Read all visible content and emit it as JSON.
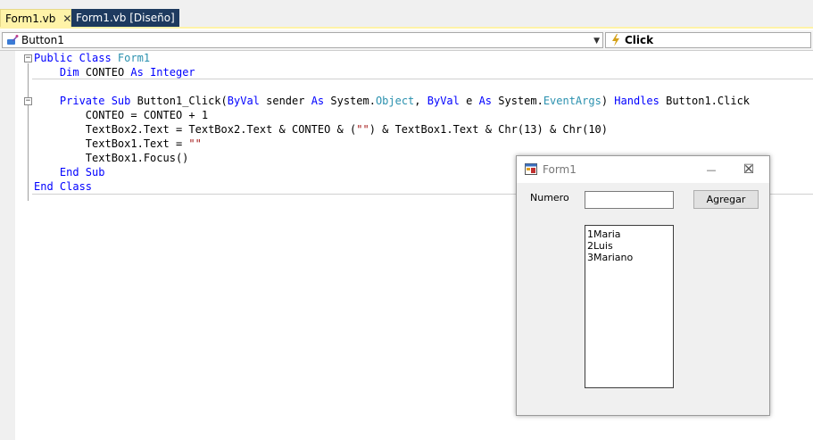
{
  "tabs": {
    "active_label": "Form1.vb",
    "active_close": "✕",
    "design_label": "Form1.vb [Diseño]"
  },
  "navbar": {
    "object_combo": "Button1",
    "event_combo": "Click"
  },
  "code_lines": [
    [
      [
        "kw",
        "Public Class "
      ],
      [
        "ty",
        "Form1"
      ]
    ],
    [
      [
        "",
        "    "
      ],
      [
        "kw",
        "Dim"
      ],
      [
        "",
        " CONTEO "
      ],
      [
        "kw",
        "As Integer"
      ]
    ],
    [],
    [
      [
        "",
        "    "
      ],
      [
        "kw",
        "Private Sub"
      ],
      [
        "",
        " Button1_Click("
      ],
      [
        "kw",
        "ByVal"
      ],
      [
        "",
        " sender "
      ],
      [
        "kw",
        "As"
      ],
      [
        "",
        " System."
      ],
      [
        "ty",
        "Object"
      ],
      [
        "",
        ", "
      ],
      [
        "kw",
        "ByVal"
      ],
      [
        "",
        " e "
      ],
      [
        "kw",
        "As"
      ],
      [
        "",
        " System."
      ],
      [
        "ty",
        "EventArgs"
      ],
      [
        "",
        ") "
      ],
      [
        "kw",
        "Handles"
      ],
      [
        "",
        " Button1.Click"
      ]
    ],
    [
      [
        "",
        "        CONTEO = CONTEO + 1"
      ]
    ],
    [
      [
        "",
        "        TextBox2.Text = TextBox2.Text & CONTEO & ("
      ],
      [
        "st",
        "\"\""
      ],
      [
        "",
        ") & TextBox1.Text & Chr(13) & Chr(10)"
      ]
    ],
    [
      [
        "",
        "        TextBox1.Text = "
      ],
      [
        "st",
        "\"\""
      ]
    ],
    [
      [
        "",
        "        TextBox1.Focus()"
      ]
    ],
    [
      [
        "",
        "    "
      ],
      [
        "kw",
        "End Sub"
      ]
    ],
    [
      [
        "kw",
        "End Class"
      ]
    ]
  ],
  "form_window": {
    "title": "Form1",
    "minimize": "—",
    "maximize": "☐",
    "close": "✕",
    "label_numero": "Numero",
    "textbox1_value": "",
    "button_agregar": "Agregar",
    "textbox2_lines": [
      "1Maria",
      "2Luis",
      "3Mariano"
    ]
  }
}
